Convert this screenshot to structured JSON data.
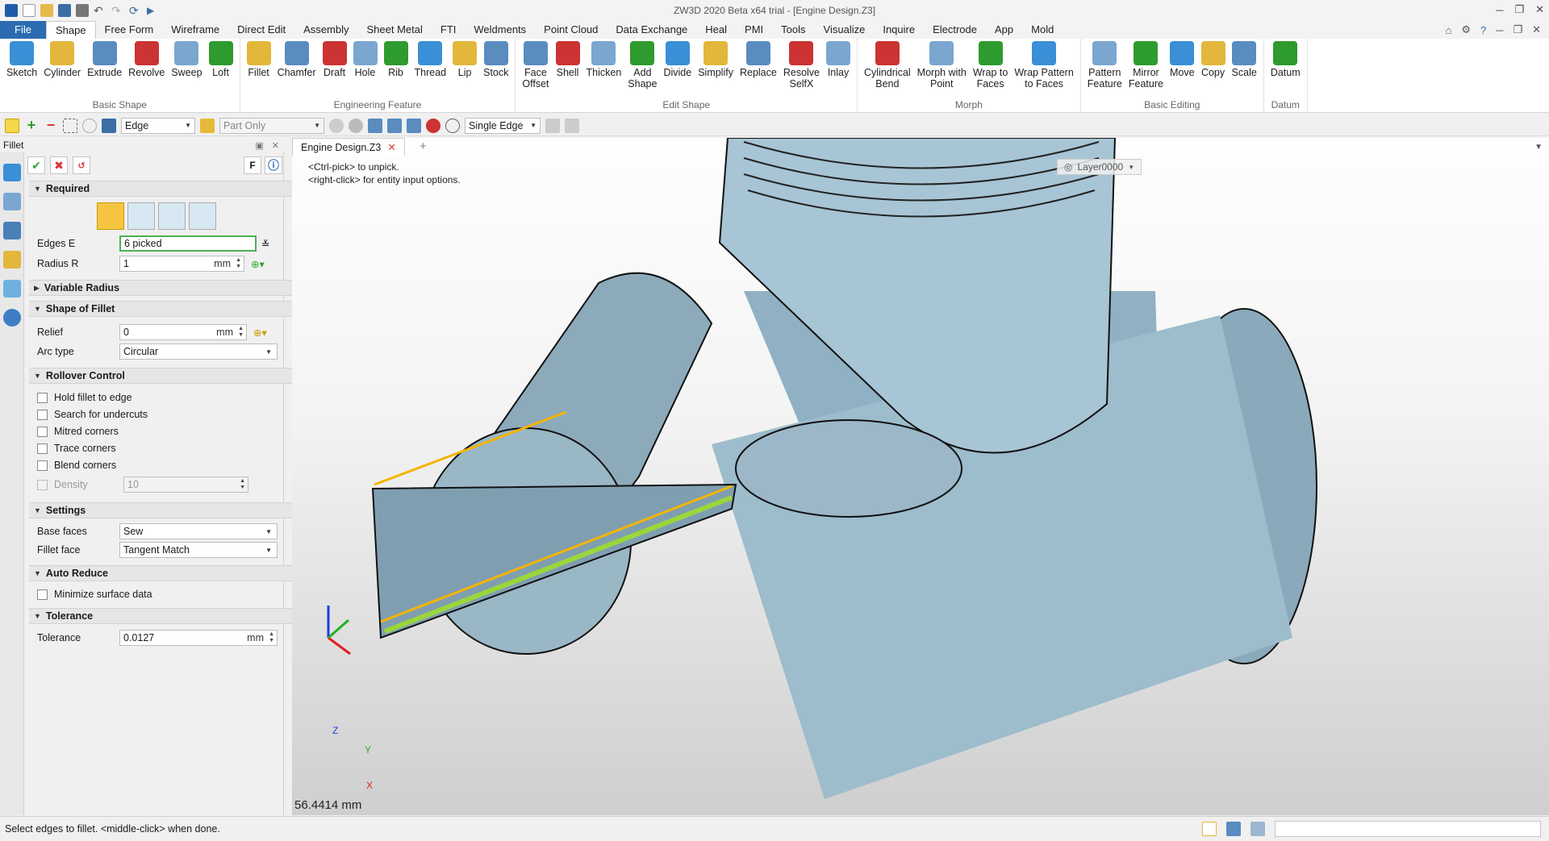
{
  "window": {
    "title": "ZW3D 2020 Beta x64 trial - [Engine Design.Z3]"
  },
  "menu": {
    "items": [
      "File",
      "Shape",
      "Free Form",
      "Wireframe",
      "Direct Edit",
      "Assembly",
      "Sheet Metal",
      "FTI",
      "Weldments",
      "Point Cloud",
      "Data Exchange",
      "Heal",
      "PMI",
      "Tools",
      "Visualize",
      "Inquire",
      "Electrode",
      "App",
      "Mold"
    ],
    "active": "Shape"
  },
  "ribbon": {
    "groups": [
      {
        "label": "Basic Shape",
        "buttons": [
          "Sketch",
          "Cylinder",
          "Extrude",
          "Revolve",
          "Sweep",
          "Loft"
        ]
      },
      {
        "label": "Engineering Feature",
        "buttons": [
          "Fillet",
          "Chamfer",
          "Draft",
          "Hole",
          "Rib",
          "Thread",
          "Lip",
          "Stock"
        ]
      },
      {
        "label": "Edit Shape",
        "buttons": [
          "Face\nOffset",
          "Shell",
          "Thicken",
          "Add\nShape",
          "Divide",
          "Simplify",
          "Replace",
          "Resolve\nSelfX",
          "Inlay"
        ]
      },
      {
        "label": "Morph",
        "buttons": [
          "Cylindrical\nBend",
          "Morph with\nPoint",
          "Wrap to\nFaces",
          "Wrap Pattern\nto Faces"
        ]
      },
      {
        "label": "Basic Editing",
        "buttons": [
          "Pattern\nFeature",
          "Mirror\nFeature",
          "Move",
          "Copy",
          "Scale"
        ]
      },
      {
        "label": "Datum",
        "buttons": [
          "Datum"
        ]
      }
    ]
  },
  "toolbar": {
    "filter": "Edge",
    "scope": "Part Only",
    "pick_mode": "Single Edge"
  },
  "panel": {
    "title": "Fillet",
    "f_label": "F",
    "sections": {
      "required": "Required",
      "variable_radius": "Variable Radius",
      "shape_of_fillet": "Shape of Fillet",
      "rollover": "Rollover Control",
      "settings": "Settings",
      "auto_reduce": "Auto Reduce",
      "tolerance": "Tolerance"
    },
    "edges": {
      "label": "Edges E",
      "value": "6 picked"
    },
    "radius": {
      "label": "Radius R",
      "value": "1",
      "unit": "mm"
    },
    "relief": {
      "label": "Relief",
      "value": "0",
      "unit": "mm"
    },
    "arc_type": {
      "label": "Arc type",
      "value": "Circular"
    },
    "rollover_options": [
      "Hold fillet to edge",
      "Search for undercuts",
      "Mitred corners",
      "Trace corners",
      "Blend corners"
    ],
    "density": {
      "label": "Density",
      "value": "10"
    },
    "base_faces": {
      "label": "Base faces",
      "value": "Sew"
    },
    "fillet_face": {
      "label": "Fillet face",
      "value": "Tangent Match"
    },
    "minimize": "Minimize surface data",
    "tolerance_field": {
      "label": "Tolerance",
      "value": "0.0127",
      "unit": "mm"
    }
  },
  "viewport": {
    "tab": "Engine Design.Z3",
    "hint_lines": [
      "<Ctrl-pick> to unpick.",
      "<right-click> for entity input options."
    ],
    "layer": "Layer0000",
    "measure": "56.4414 mm",
    "axes": {
      "x": "X",
      "y": "Y",
      "z": "Z"
    }
  },
  "status": {
    "text": "Select edges to fillet.  <middle-click> when done."
  },
  "colors": {
    "accent": "#2b6cb0",
    "model": "#a9c4d2",
    "highlight": "#f5b400",
    "selected": "#9bd63a"
  }
}
